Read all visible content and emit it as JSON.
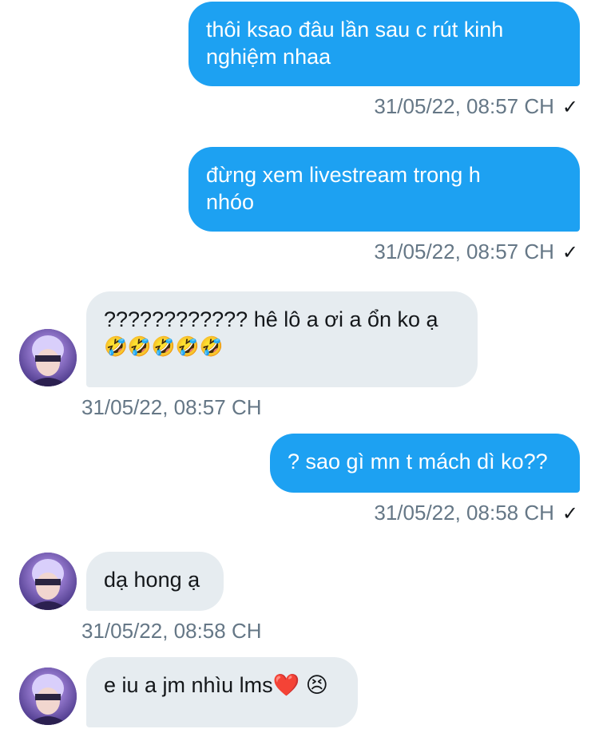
{
  "messages": [
    {
      "direction": "out",
      "lines": [
        "thôi ksao đâu lần sau c rút kinh",
        "nghiệm nhaa"
      ],
      "time": "31/05/22, 08:57 CH",
      "status_icon": "✓"
    },
    {
      "direction": "out",
      "lines": [
        "đừng xem livestream trong h",
        "nhóo"
      ],
      "time": "31/05/22, 08:57 CH",
      "status_icon": "✓"
    },
    {
      "direction": "in",
      "lines": [
        "???????????? hê lô a ơi a ổn ko ạ",
        "🤣🤣🤣🤣🤣"
      ],
      "time": "31/05/22, 08:57 CH"
    },
    {
      "direction": "out",
      "lines": [
        "? sao gì mn t mách dì ko??"
      ],
      "time": "31/05/22, 08:58 CH",
      "status_icon": "✓"
    },
    {
      "direction": "in",
      "lines": [
        "dạ hong ạ"
      ],
      "time": "31/05/22, 08:58 CH"
    },
    {
      "direction": "in",
      "lines": [
        "e iu a jm nhìu lms❤️ 😣"
      ]
    }
  ],
  "colors": {
    "outgoing_bubble": "#1da1f2",
    "incoming_bubble": "#e6ecf0",
    "timestamp": "#657786"
  },
  "icons": {
    "avatar": "avatar-photo",
    "status": "checkmark-icon"
  }
}
